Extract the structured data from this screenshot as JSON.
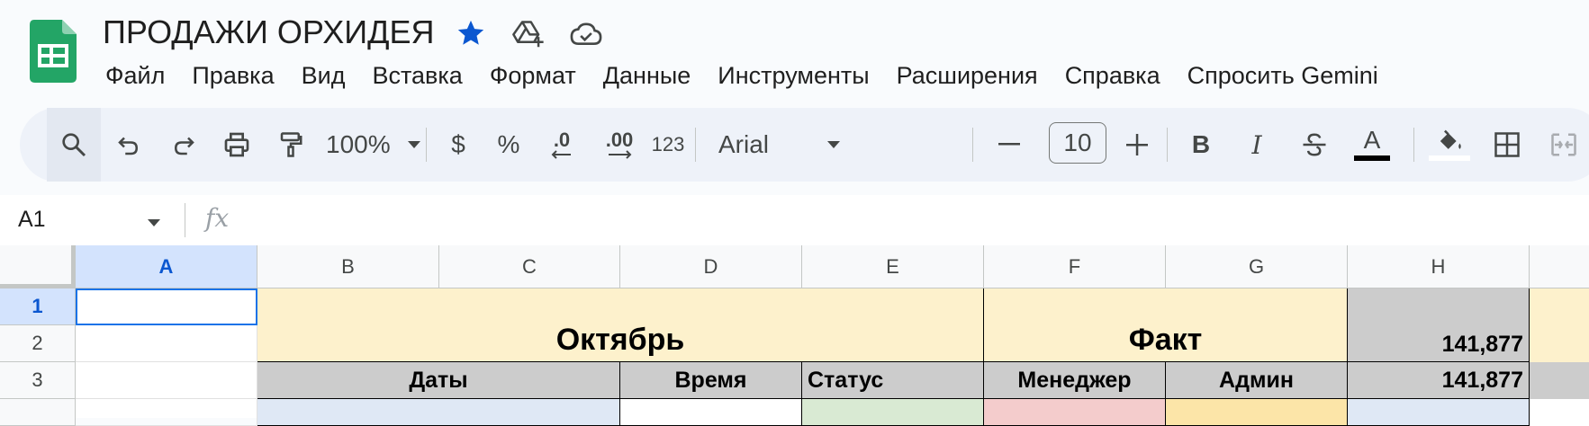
{
  "doc": {
    "title": "ПРОДАЖИ ОРХИДЕЯ"
  },
  "menu": [
    "Файл",
    "Правка",
    "Вид",
    "Вставка",
    "Формат",
    "Данные",
    "Инструменты",
    "Расширения",
    "Справка",
    "Спросить Gemini"
  ],
  "toolbar": {
    "zoom": "100%",
    "currency": "$",
    "percent": "%",
    "decrease_decimal": ".0",
    "increase_decimal": ".00",
    "number_format": "123",
    "font": "Arial",
    "font_size": "10",
    "bold": "B",
    "italic": "I",
    "text_color_letter": "A"
  },
  "formula_bar": {
    "cell_ref": "A1",
    "fx": "fx"
  },
  "columns": [
    "A",
    "B",
    "C",
    "D",
    "E",
    "F",
    "G",
    "H"
  ],
  "rows": [
    "1",
    "2",
    "3"
  ],
  "sheet": {
    "merged_october": "Октябрь",
    "merged_fact": "Факт",
    "h2": "141,877",
    "row3": {
      "b": "Даты",
      "d": "Время",
      "e": "Статус",
      "f": "Менеджер",
      "g": "Админ",
      "h": "141,877"
    }
  },
  "colors": {
    "accent": "#0b57d0",
    "header_yellow": "#fdf1cc",
    "header_gray": "#cccccc",
    "logo_green": "#1e8e3e"
  }
}
